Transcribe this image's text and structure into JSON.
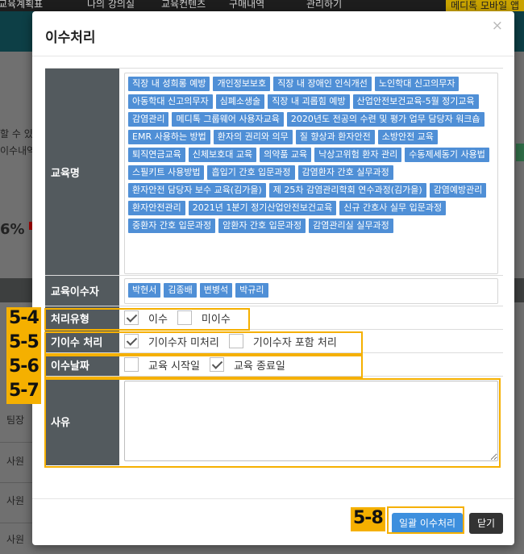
{
  "background": {
    "nav_items": [
      "교육계획표",
      "나의 강의실",
      "교육컨텐츠",
      "구매내역",
      "관리하기"
    ],
    "mobile_label": "메디톡 모바일 앱",
    "fragments": [
      "할 수 있",
      "이수내역",
      "6%",
      "팀장",
      "사원",
      "사원",
      "사원"
    ]
  },
  "modal": {
    "title": "이수처리",
    "close_glyph": "×",
    "rows": {
      "course_label": "교육명",
      "completers_label": "교육이수자",
      "type_label": "처리유형",
      "existing_label": "기이수 처리",
      "date_label": "이수날짜",
      "reason_label": "사유"
    },
    "courses": [
      "직장 내 성희롱 예방",
      "개인정보보호",
      "직장 내 장애인 인식개선",
      "노인학대 신고의무자",
      "아동학대 신고의무자",
      "심폐소생술",
      "직장 내 괴롭힘 예방",
      "산업안전보건교육-5월 정기교육",
      "감염관리",
      "메디톡 그룹웨어 사용자교육",
      "2020년도 전공의 수련 및 평가 업무 담당자 워크숍",
      "EMR 사용하는 방법",
      "환자의 권리와 의무",
      "질 향상과 환자안전",
      "소방안전 교육",
      "퇴직연금교육",
      "신체보호대 교육",
      "의약품 교육",
      "낙상고위험 환자 관리",
      "수동제세동기 사용법",
      "스필키트 사용방법",
      "흡입기 간호 입문과정",
      "감염환자 간호 실무과정",
      "환자안전 담당자 보수 교육(김가을)",
      "제 25차 감염관리학회 연수과정(김가을)",
      "감염예방관리",
      "환자안전관리",
      "2021년 1분기 정기산업안전보건교육",
      "신규 간호사 실무 입문과정",
      "중환자 간호 입문과정",
      "암환자 간호 입문과정",
      "감염관리실 실무과정"
    ],
    "completers": [
      "박현서",
      "김종배",
      "변병석",
      "박규리"
    ],
    "type_options": [
      {
        "label": "이수",
        "checked": true
      },
      {
        "label": "미이수",
        "checked": false
      }
    ],
    "existing_options": [
      {
        "label": "기이수자 미처리",
        "checked": true
      },
      {
        "label": "기이수자 포함 처리",
        "checked": false
      }
    ],
    "date_options": [
      {
        "label": "교육 시작일",
        "checked": false
      },
      {
        "label": "교육 종료일",
        "checked": true
      }
    ],
    "reason_value": "",
    "footer": {
      "submit_label": "일괄 이수처리",
      "close_label": "닫기"
    }
  },
  "annotations": [
    "5-4",
    "5-5",
    "5-6",
    "5-7",
    "5-8"
  ],
  "colors": {
    "accent": "#f5b000",
    "tag": "#4f8fd6",
    "header_cell": "#535a5e",
    "primary_button": "#3d8fde"
  }
}
